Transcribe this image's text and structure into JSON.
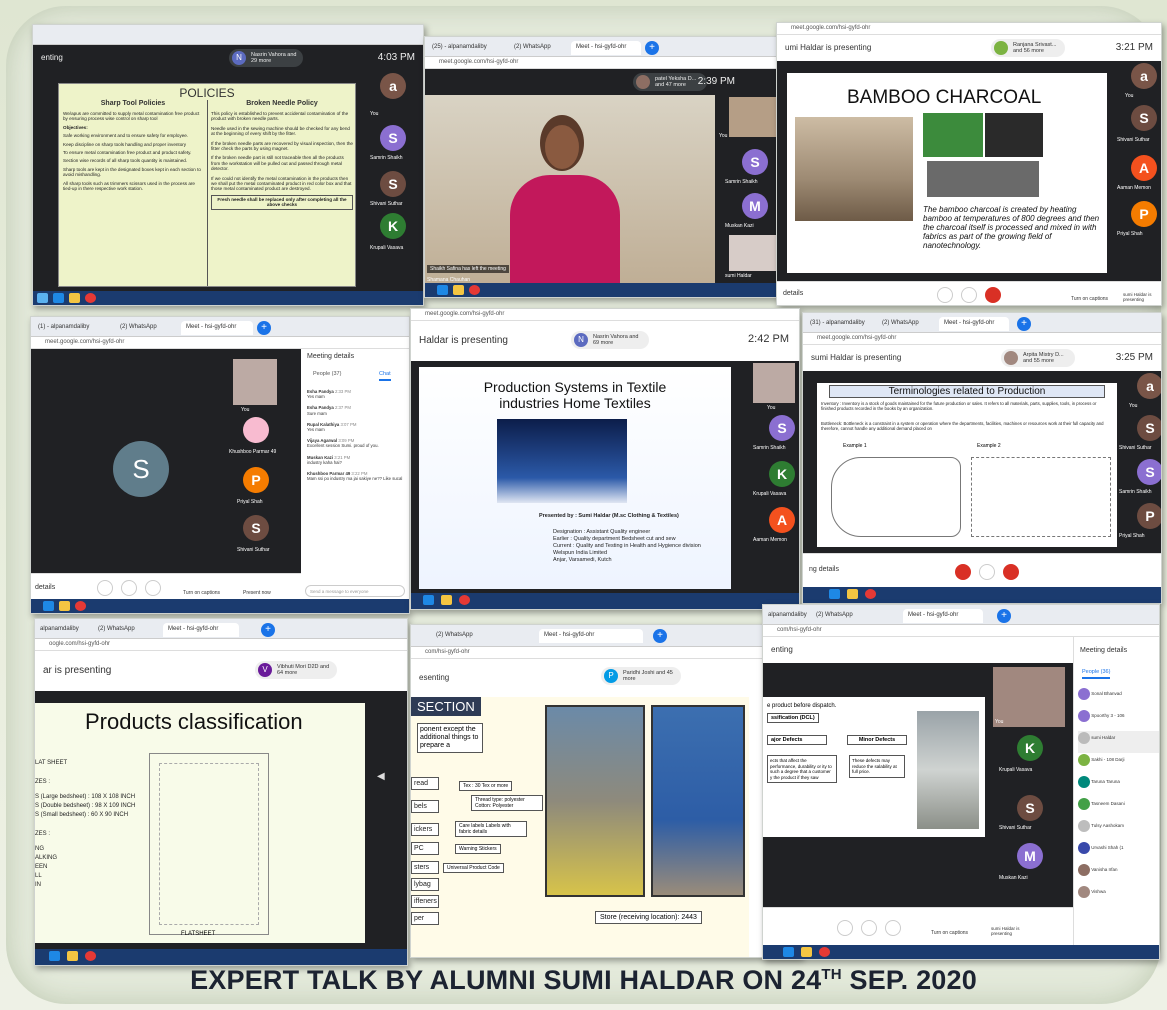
{
  "caption": {
    "main": "EXPERT TALK BY ALUMNI SUMI HALDAR ON 24",
    "sup": "TH",
    "tail": " SEP. 2020"
  },
  "s1": {
    "presenting": "enting",
    "who_initial": "N",
    "who_label": "Nasrin Vahora and 29 more",
    "time": "4:03 PM",
    "title": "POLICIES",
    "col_left": "Sharp Tool Policies",
    "col_right": "Broken Needle Policy",
    "left_items": [
      "We/apus are committed to supply metal contamination free product by ensuring process wise control on sharp tool",
      "Objectives:",
      "Safe working environment and to ensure safety for employee.",
      "Keep discipline on sharp tools handling and proper inventory",
      "To ensure metal contamination free product and product safety.",
      "Section wise records of all sharp tools quantity is maintained.",
      "Sharp tools are kept in the designated boxes kept in each section to avoid mishandling.",
      "All sharp tools such as trimmers scissors used in the process are tied-up in there respective work station."
    ],
    "right_items": [
      "This policy is established to prevent accidental contamination of the product with broken needle parts.",
      "Needle used in the sewing machine should be checked for any bend at the beginning of every shift by the fitter.",
      "If the broken needle parts are recovered by visual inspection, then the fitter check the parts by using magnet.",
      "If the broken needle part is still not traceable then all the products from the workstation will be pulled out and passed through metal detector.",
      "If we could not identify the metal contamination in the products then we shall put the metal contaminated product in red color box and that those metal contaminated product are destroyed."
    ],
    "right_note": "Fresh needle shall be replaced only after completing all the above checks",
    "tiles": [
      {
        "i": "a",
        "name": ""
      },
      {
        "i": "S",
        "name": "You"
      },
      {
        "i": "S",
        "name": "Samrin Shaikh"
      },
      {
        "i": "S",
        "name": "Shivani Suthar"
      },
      {
        "i": "K",
        "name": "Krupali Vasava"
      }
    ]
  },
  "s2": {
    "tab1": "(25) - alpanamdaliby",
    "tab2": "(2) WhatsApp",
    "tab3": "Meet - hsi-gyfd-ohr",
    "url": "meet.google.com/hsi-gyfd-ohr",
    "who_label": "patel Yeksha D... and 47 more",
    "time": "2:39 PM",
    "notice": "Shaikh Safina has left the meeting",
    "caption_name": "Shamana Chauhan",
    "tiles": [
      {
        "i": "S",
        "name": "Samrin Shaikh"
      },
      {
        "i": "M",
        "name": "Muskan Kazi"
      }
    ],
    "you": "You",
    "tile_name": "sumi Haldar"
  },
  "s3": {
    "url": "meet.google.com/hsi-gyfd-ohr",
    "presenting": "umi Haldar is presenting",
    "who_label": "Ranjana Srivast... and 56 more",
    "time": "3:21 PM",
    "title": "BAMBOO CHARCOAL",
    "body": "The bamboo charcoal is created by heating bamboo at temperatures of 800 degrees and then the charcoal itself is processed and mixed in with fabrics as part of the growing field of nanotechnology.",
    "details": "details",
    "captions": "Turn on captions",
    "present": "sumi Haldar is presenting",
    "tiles": [
      {
        "i": "a",
        "name": "You"
      },
      {
        "i": "S",
        "name": "Shivani Suthar"
      },
      {
        "i": "A",
        "name": "Aaman Memon"
      },
      {
        "i": "P",
        "name": "Priyal Shah"
      }
    ]
  },
  "s4": {
    "tab1": "(1) - alpanamdaliby",
    "tab2": "(2) WhatsApp",
    "tab3": "Meet - hsi-gyfd-ohr",
    "url": "meet.google.com/hsi-gyfd-ohr",
    "big_initial": "S",
    "tiles": [
      {
        "i": "",
        "name": "You"
      },
      {
        "i": "",
        "name": "Khushboo Parmar 49"
      },
      {
        "i": "P",
        "name": "Priyal Shah"
      },
      {
        "i": "S",
        "name": "Shivani Suthar"
      }
    ],
    "panel_title": "Meeting details",
    "people": "People (37)",
    "chat": "Chat",
    "messages": [
      {
        "from": "Esha Pandya",
        "time": "2:33 PM",
        "text": "Yes mam"
      },
      {
        "from": "Esha Pandya",
        "time": "2:37 PM",
        "text": "Sure mam"
      },
      {
        "from": "Rupal Kalathiya",
        "time": "3:07 PM",
        "text": "Yes mam"
      },
      {
        "from": "Vijaya Agarwal",
        "time": "3:09 PM",
        "text": "Excellent session Sumi. proud of you."
      },
      {
        "from": "Muskan Kazi",
        "time": "3:21 PM",
        "text": "industry kaha hai?"
      },
      {
        "from": "Khushboo Parmar 49",
        "time": "3:22 PM",
        "text": "Mam ssi po industry ma jai sakiye ne?? Like sucal"
      }
    ],
    "send_placeholder": "Send a message to everyone",
    "details": "details",
    "captions": "Turn on captions",
    "present": "Present now"
  },
  "s5": {
    "url": "meet.google.com/hsi-gyfd-ohr",
    "presenting": "Haldar is presenting",
    "who_initial": "N",
    "who_label": "Nasrin Vahora and 69 more",
    "time": "2:42 PM",
    "title": "Production Systems in Textile industries Home Textiles",
    "presented": "Presented by : Sumi Haldar (M.sc Clothing & Textiles)",
    "lines": [
      "Designation : Assistant Quality engineer",
      "Earlier : Quality department Bedsheet cut and sew",
      "Current : Quality and Testing in Health and Hygience division",
      "Welspun India Limited",
      "Anjar, Varsamedi, Kutch"
    ],
    "tiles": [
      {
        "i": "",
        "name": "You"
      },
      {
        "i": "S",
        "name": "Samrin Shaikh"
      },
      {
        "i": "K",
        "name": "Krupali Vasava"
      },
      {
        "i": "A",
        "name": "Aaman Memon"
      }
    ]
  },
  "s6": {
    "tab1": "(31) - alpanamdaliby",
    "tab2": "(2) WhatsApp",
    "tab3": "Meet - hsi-gyfd-ohr",
    "url": "meet.google.com/hsi-gyfd-ohr",
    "presenting": "sumi Haldar is presenting",
    "who_label": "Arpita Mistry D... and 55 more",
    "time": "3:25 PM",
    "title": "Terminologies related to Production",
    "inventory": "Inventory : Inventory is a stock of goods maintained for the future production or sales. It refers to all materials, parts, supplies, tools, in process or finished products recorded in the books by an organization.",
    "bottleneck": "Bottleneck: Bottleneck is a constraint in a system or operation where the departments, facilities, machines or resources work at their full capacity and therefore, cannot handle any additional demand placed on",
    "ex1": "Example 1",
    "ex2": "Example 2",
    "details": "ng details",
    "tiles": [
      {
        "i": "a",
        "name": "You"
      },
      {
        "i": "S",
        "name": "Shivani Suthar"
      },
      {
        "i": "S",
        "name": "Samrin Shaikh"
      },
      {
        "i": "P",
        "name": "Priyal Shah"
      }
    ]
  },
  "s7": {
    "tab1": "alpanamdaliby",
    "tab2": "(2) WhatsApp",
    "tab3": "Meet - hsi-gyfd-ohr",
    "url": "oogle.com/hsi-gyfd-ohr",
    "presenting": "ar is presenting",
    "who_initial": "V",
    "who_label": "Vibhuti Mori D2D and 64 more",
    "title": "Products classification",
    "lines": [
      "LAT SHEET",
      "ZES :",
      "S (Large bedsheet) : 108 X 108 INCH",
      "S (Double bedsheet) : 98 X 109 INCH",
      "S (Small bedsheet) : 60 X 90 INCH",
      "ZES :",
      "NG",
      "ALKING",
      "EEN",
      "LL",
      "IN"
    ],
    "flat": "FLATSHEET"
  },
  "s8": {
    "tab2": "(2) WhatsApp",
    "tab3": "Meet - hsi-gyfd-ohr",
    "url": "com/hsi-gyfd-ohr",
    "presenting": "esenting",
    "who_initial": "P",
    "who_label": "Paridhi Joshi and 45 more",
    "heading": "SECTION",
    "intro": "ponent except the additional things to prepare a",
    "labels": [
      "read",
      "bels",
      "ickers",
      "PC",
      "sters",
      "lybag",
      "iffeners",
      "per"
    ],
    "notes": [
      "Tex : 30 Tex or more",
      "Thread type: polyester Cotton: Polyester",
      "Care labels Labels with fabric details",
      "Warning Stickers",
      "Universal Product Code"
    ],
    "store": "Store (receiving location): 2443"
  },
  "s9": {
    "tab1": "alpanamdaliby",
    "tab2": "(2) WhatsApp",
    "tab3": "Meet - hsi-gyfd-ohr",
    "url": "com/hsi-gyfd-ohr",
    "presenting": "enting",
    "heading": "e product before dispatch.",
    "class": "ssification (DCL)",
    "major": "ajor Defects",
    "minor": "Minor Defects",
    "major_text": "ects that affect the performance, durability or ity to such a degree that a customer y the product if they saw",
    "minor_text": "These defects may reduce the salability at full price.",
    "panel_title": "Meeting details",
    "people": "People (36)",
    "people_list": [
      "Sonal Bhanvad",
      "Spoorthy 3 - 106",
      "sumi Haldar",
      "Sakhi - 108 Darji",
      "Taruna Taruna",
      "Tasneem Dasani",
      "Tulsy Aashokam",
      "Urvashi Shah (1",
      "Vanisha Irfan",
      "Vishwa"
    ],
    "tiles": [
      {
        "i": "",
        "name": "You"
      },
      {
        "i": "K",
        "name": "Krupali Vasava"
      },
      {
        "i": "S",
        "name": "Shivani Suthar"
      },
      {
        "i": "M",
        "name": "Muskan Kazi"
      }
    ],
    "captions": "Turn on captions",
    "present": "sumi Haldar is presenting"
  },
  "colors": {
    "meet_dark": "#202124",
    "purple": "#8b6fd1",
    "orange": "#f57c00",
    "green": "#2e7d32",
    "brown": "#795548",
    "blue": "#1a73e8",
    "red": "#d93025"
  }
}
